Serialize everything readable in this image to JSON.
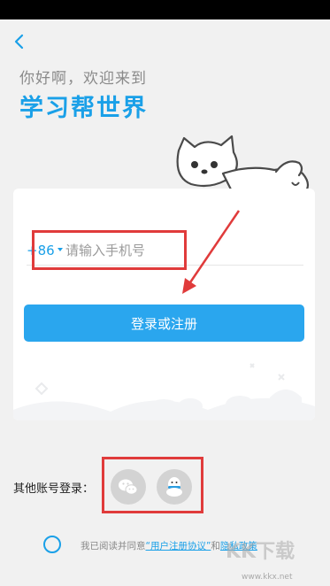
{
  "header": {
    "back_icon": "chevron-left-icon",
    "greeting": "你好啊，欢迎来到",
    "title": "学习帮世界"
  },
  "login": {
    "country_code": "+86",
    "phone_placeholder": "请输入手机号",
    "submit_label": "登录或注册"
  },
  "social": {
    "label": "其他账号登录：",
    "providers": [
      {
        "name": "WeChat",
        "icon": "wechat-icon"
      },
      {
        "name": "QQ",
        "icon": "qq-icon"
      }
    ]
  },
  "agreement": {
    "prefix": "我已阅读并同意",
    "user_agreement": "“用户注册协议”",
    "conjunction": "和",
    "privacy_policy": "隐私政策"
  },
  "watermark": {
    "logo": "KK下载",
    "url": "www.kkx.net"
  },
  "colors": {
    "accent": "#1aa0e8",
    "button": "#2aa6ee",
    "annotation": "#e03b3b",
    "background": "#f1f1f1"
  }
}
